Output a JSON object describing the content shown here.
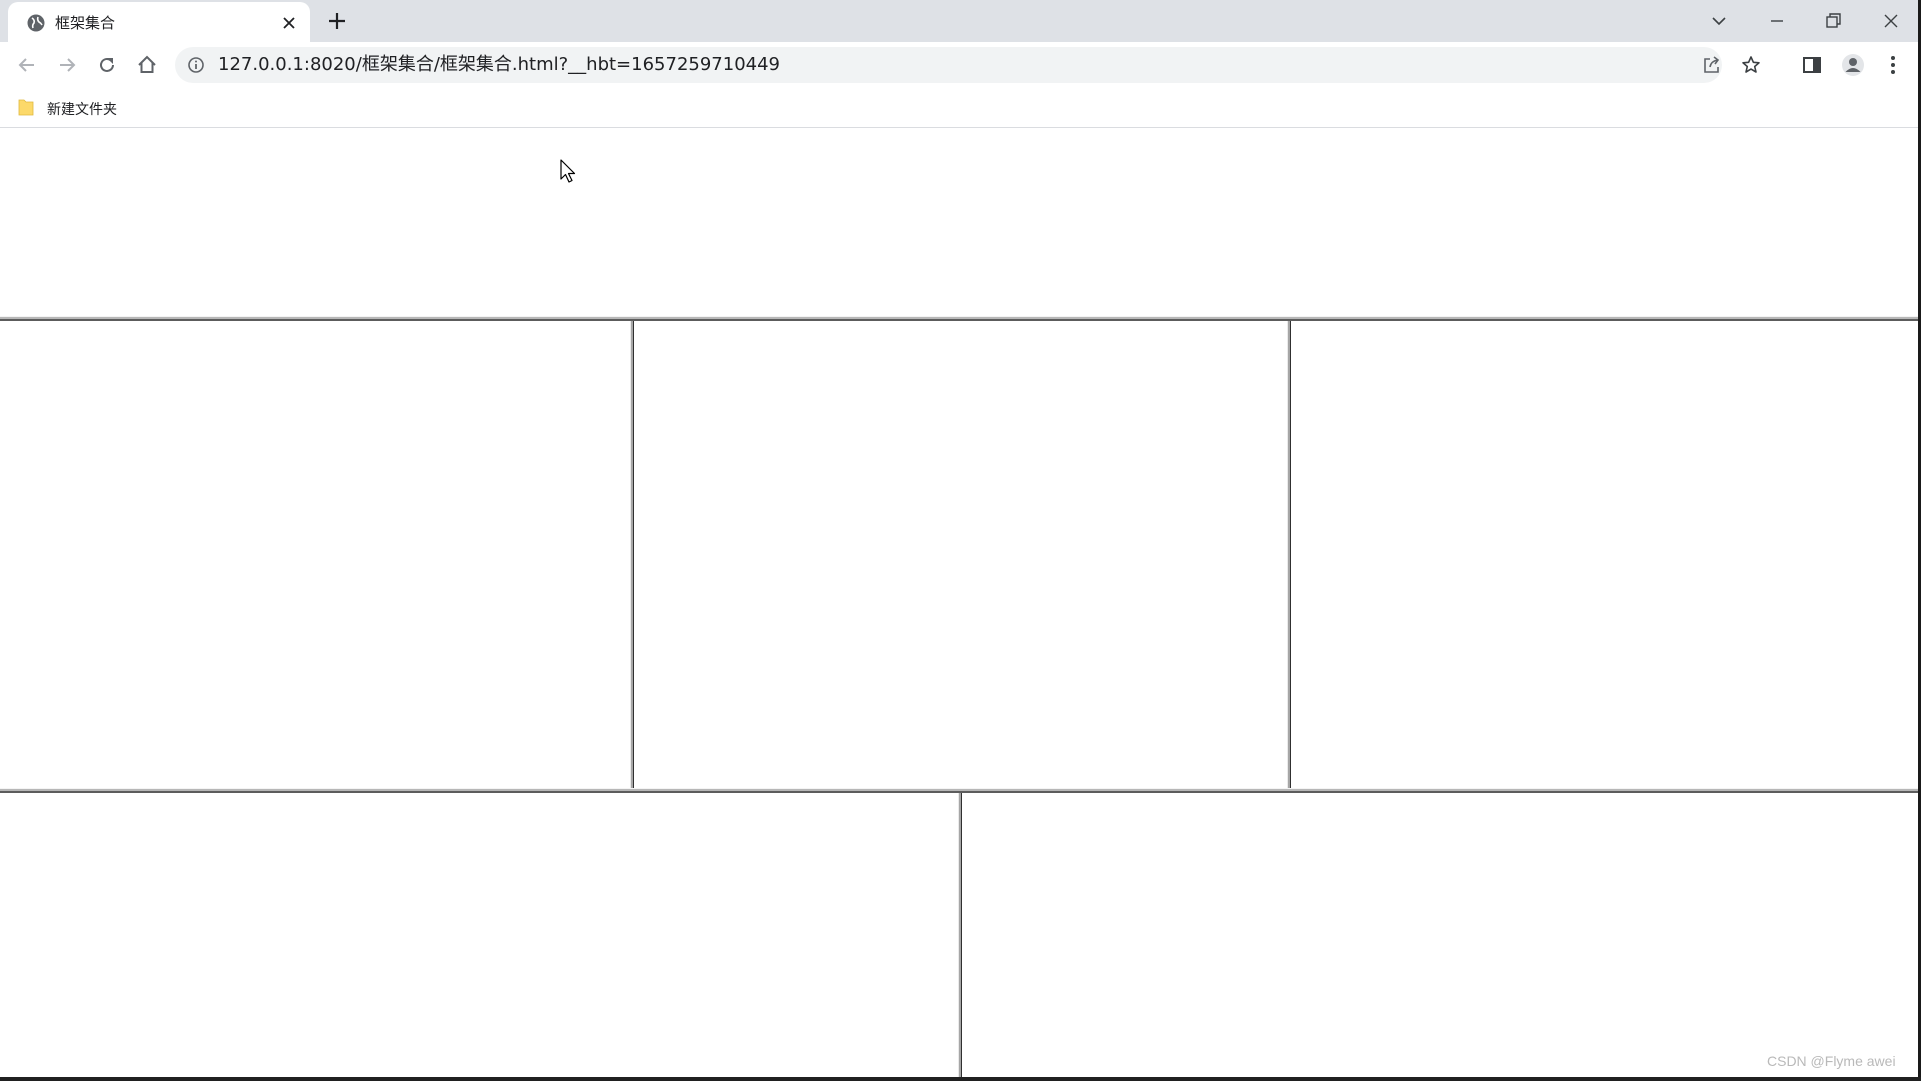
{
  "browser": {
    "tab": {
      "title": "框架集合"
    },
    "address_bar": {
      "url": "127.0.0.1:8020/框架集合/框架集合.html?__hbt=1657259710449"
    },
    "bookmarks": [
      {
        "label": "新建文件夹",
        "icon": "folder-icon"
      }
    ]
  },
  "frameset": {
    "rows": [
      {
        "frames": 1
      },
      {
        "frames": 3
      },
      {
        "frames": 2
      }
    ]
  },
  "watermark": "CSDN @Flyme awei",
  "colors": {
    "tab_strip": "#dee1e6",
    "omnibox": "#f1f3f4",
    "folder": "#fcd96a",
    "frame_border_dark": "#303030",
    "frame_border_light": "#a6a6a6"
  }
}
